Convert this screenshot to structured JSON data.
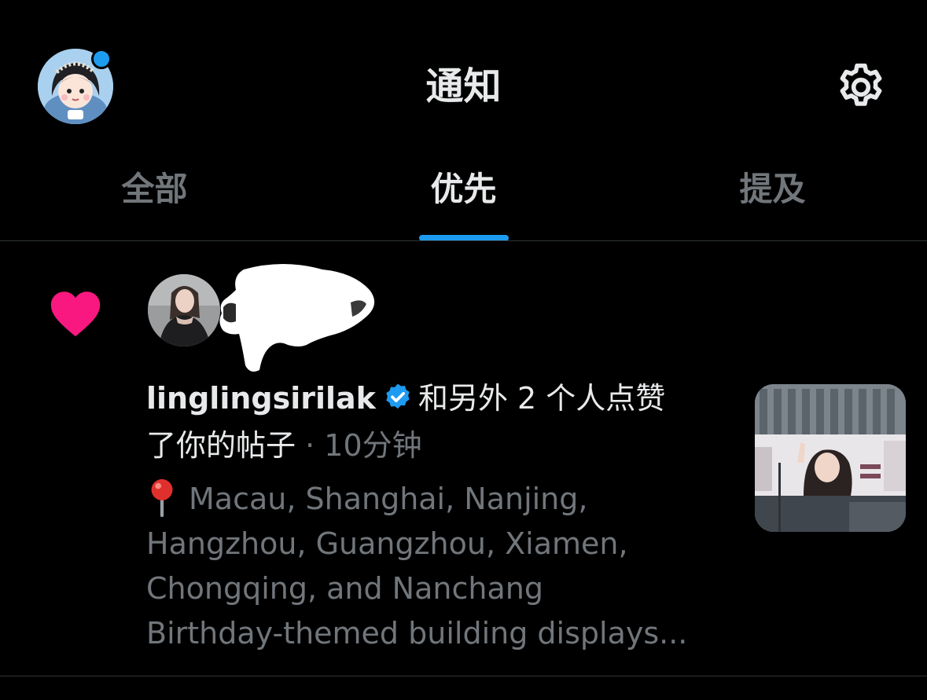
{
  "header": {
    "title": "通知",
    "settings_icon": "gear-icon"
  },
  "tabs": [
    {
      "label": "全部",
      "active": false
    },
    {
      "label": "优先",
      "active": true
    },
    {
      "label": "提及",
      "active": false
    }
  ],
  "notification": {
    "type_icon": "heart-icon",
    "username": "linglingsirilak",
    "verified": true,
    "action_text": "和另外 2 个人点赞",
    "action_text_2": "了你的帖子",
    "separator": "·",
    "time": "10分钟",
    "preview": {
      "pin_icon": "round-pushpin-icon",
      "line1": "Macau, Shanghai, Nanjing,",
      "line2": "Hangzhou, Guangzhou, Xiamen,",
      "line3": "Chongqing, and Nanchang",
      "line4": "Birthday-themed building displays..."
    }
  },
  "colors": {
    "background": "#000000",
    "primary_text": "#e7e9ea",
    "secondary_text": "#71767b",
    "accent": "#1d9bf0",
    "like": "#f91880",
    "divider": "#2f3336"
  }
}
